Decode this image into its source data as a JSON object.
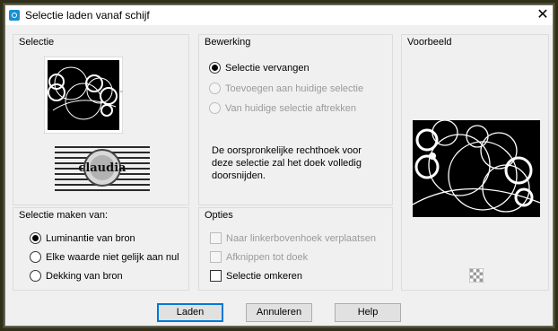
{
  "window": {
    "title": "Selectie laden vanaf schijf",
    "close_symbol": "✕"
  },
  "selectie": {
    "label": "Selectie",
    "watermark_text": "claudia"
  },
  "bewerking": {
    "label": "Bewerking",
    "options": [
      {
        "label": "Selectie vervangen",
        "checked": true,
        "enabled": true
      },
      {
        "label": "Toevoegen aan huidige selectie",
        "checked": false,
        "enabled": false
      },
      {
        "label": "Van huidige selectie aftrekken",
        "checked": false,
        "enabled": false
      }
    ],
    "note": "De oorspronkelijke rechthoek voor deze selectie zal het doek volledig doorsnijden."
  },
  "voorbeeld": {
    "label": "Voorbeeld",
    "checker_icon": "transparency-checker-icon"
  },
  "maken_van": {
    "label": "Selectie maken van:",
    "options": [
      {
        "label": "Luminantie van bron",
        "checked": true
      },
      {
        "label": "Elke waarde niet gelijk aan nul",
        "checked": false
      },
      {
        "label": "Dekking van bron",
        "checked": false
      }
    ]
  },
  "opties": {
    "label": "Opties",
    "items": [
      {
        "label": "Naar linkerbovenhoek verplaatsen",
        "checked": false,
        "enabled": false
      },
      {
        "label": "Afknippen tot doek",
        "checked": false,
        "enabled": false
      },
      {
        "label": "Selectie omkeren",
        "checked": false,
        "enabled": true
      }
    ]
  },
  "buttons": {
    "load": "Laden",
    "cancel": "Annuleren",
    "help": "Help"
  },
  "colors": {
    "accent": "#0078d7",
    "frame": "#4a4a2a",
    "dialog_bg": "#f0f0f0"
  }
}
